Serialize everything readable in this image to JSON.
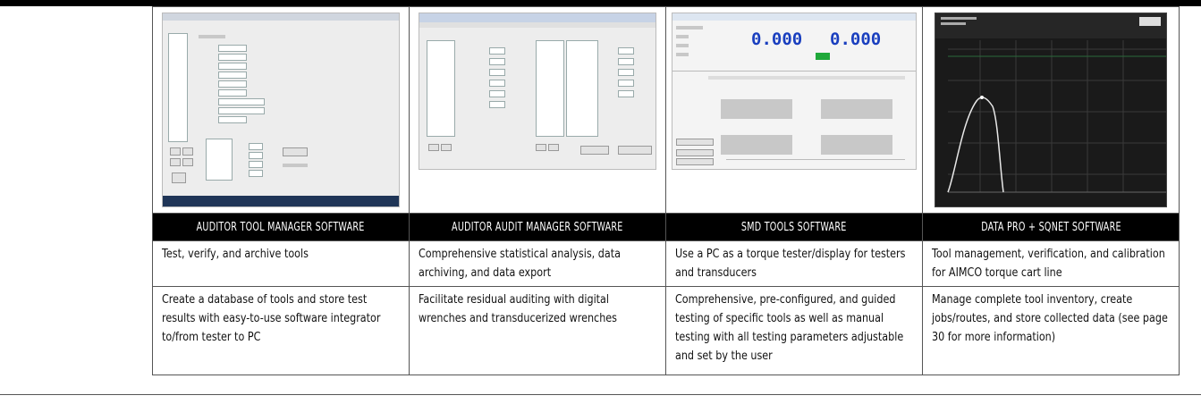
{
  "columns": [
    {
      "title": "AUDITOR TOOL MANAGER SOFTWARE",
      "summary": "Test, verify, and archive tools",
      "detail": "Create a database of tools and store test results with easy-to-use software integrator to/from tester to PC",
      "screenshot_icon": "tool-manager-screenshot"
    },
    {
      "title": "AUDITOR AUDIT MANAGER SOFTWARE",
      "summary": "Comprehensive statistical analysis, data archiving, and data export",
      "detail": "Facilitate residual auditing with digital wrenches and transducerized wrenches",
      "screenshot_icon": "audit-manager-screenshot"
    },
    {
      "title": "SMD TOOLS SOFTWARE",
      "summary": "Use a PC as a torque tester/display for testers and transducers",
      "detail": "Comprehensive, pre-configured, and guided testing of specific tools as well as manual testing with all testing parameters adjustable and set by the user",
      "screenshot_icon": "smd-tools-screenshot",
      "readouts": [
        "0.000",
        "0.000"
      ]
    },
    {
      "title": "DATA PRO + SQNET SOFTWARE",
      "summary": "Tool management, verification, and calibration for AIMCO torque cart line",
      "detail": "Manage complete tool inventory, create jobs/routes, and store collected data (see page 30 for more information)",
      "screenshot_icon": "torque-curve-screenshot"
    }
  ]
}
